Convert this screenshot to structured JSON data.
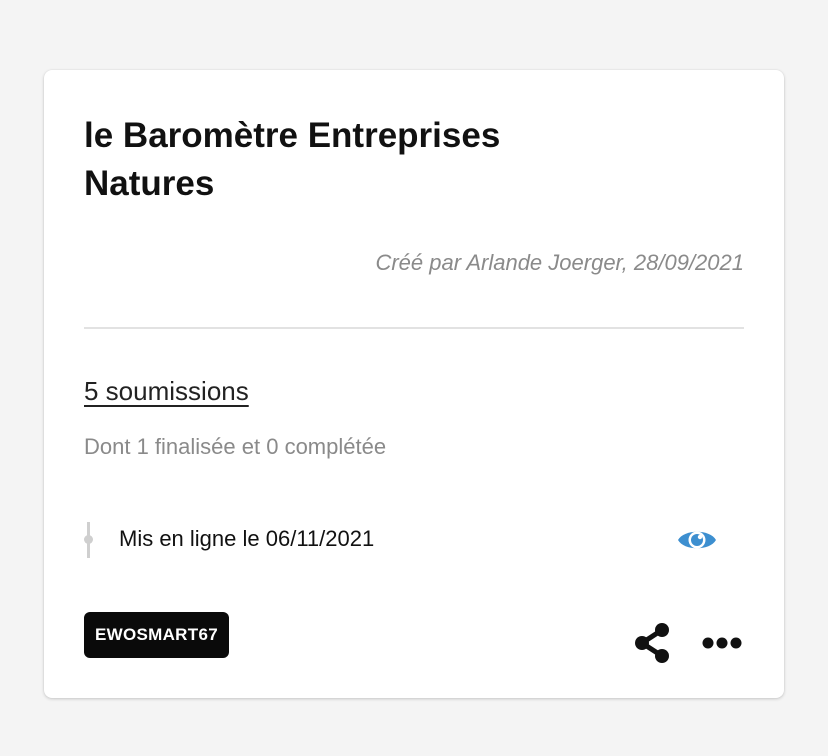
{
  "card": {
    "title": "le Baromètre Entreprises Natures",
    "creator": "Créé par Arlande Joerger, 28/09/2021",
    "submissions_link": "5 soumissions",
    "submissions_detail": "Dont 1 finalisée et 0 complétée",
    "published": "Mis en ligne le 06/11/2021",
    "tag": "EWOSMART67",
    "icons": {
      "view": "eye-icon",
      "share": "share-icon",
      "more": "more-horizontal-icon"
    }
  },
  "colors": {
    "background": "#f4f4f4",
    "card": "#ffffff",
    "accent_eye": "#3d8fd0",
    "tag_background": "#0a0a0a",
    "muted_text": "#8a8a8a"
  }
}
